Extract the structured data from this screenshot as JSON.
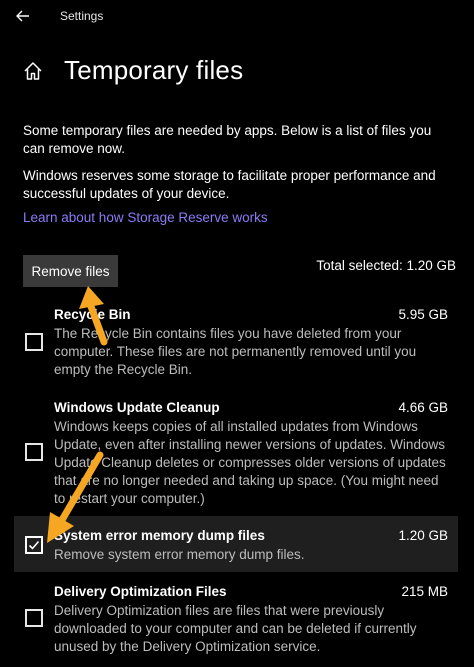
{
  "window": {
    "title": "Settings"
  },
  "page": {
    "title": "Temporary files",
    "intro1": "Some temporary files are needed by apps. Below is a list of files you can remove now.",
    "intro2": "Windows reserves some storage to facilitate proper performance and successful updates of your device.",
    "link": "Learn about how Storage Reserve works"
  },
  "actions": {
    "remove_label": "Remove files",
    "total_selected": "Total selected: 1.20 GB"
  },
  "items": [
    {
      "name": "Recycle Bin",
      "size": "5.95 GB",
      "description": "The Recycle Bin contains files you have deleted from your computer. These files are not permanently removed until you empty the Recycle Bin.",
      "checked": false
    },
    {
      "name": "Windows Update Cleanup",
      "size": "4.66 GB",
      "description": "Windows keeps copies of all installed updates from Windows Update, even after installing newer versions of updates. Windows Update Cleanup deletes or compresses older versions of updates that are no longer needed and taking up space. (You might need to restart your computer.)",
      "checked": false
    },
    {
      "name": "System error memory dump files",
      "size": "1.20 GB",
      "description": "Remove system error memory dump files.",
      "checked": true
    },
    {
      "name": "Delivery Optimization Files",
      "size": "215 MB",
      "description": "Delivery Optimization files are files that were previously downloaded to your computer and can be deleted if currently unused by the Delivery Optimization service.",
      "checked": false
    }
  ],
  "colors": {
    "background": "#000000",
    "link": "#8b7cf6",
    "button": "#3a3a3a",
    "selected_row": "#1f1f1f",
    "annotation_arrow": "#f5a623"
  },
  "icons": {
    "back": "back-arrow-icon",
    "home": "home-icon",
    "check": "checkmark-icon"
  }
}
